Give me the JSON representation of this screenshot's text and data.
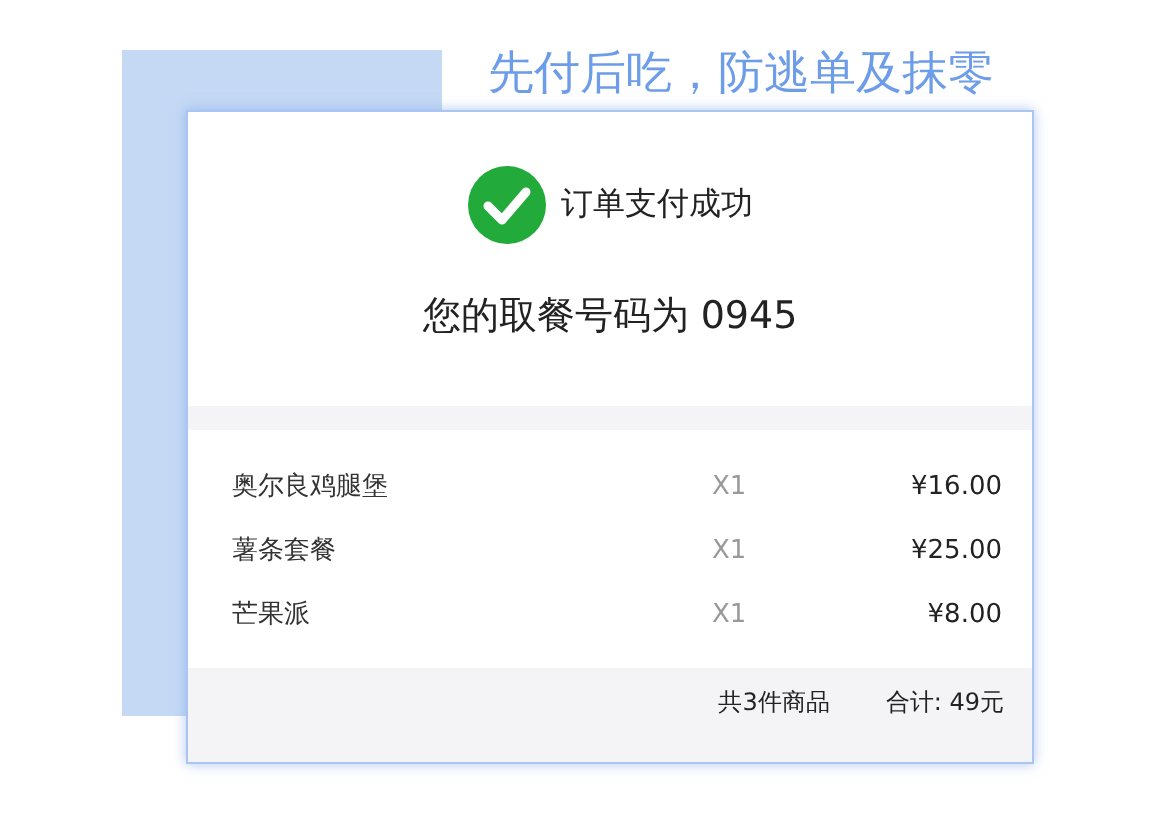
{
  "headline": "先付后吃，防逃单及抹零",
  "receipt": {
    "status": "订单支付成功",
    "pickup": "您的取餐号码为 0945",
    "items": [
      {
        "name": "奥尔良鸡腿堡",
        "qty": "X1",
        "price": "¥16.00"
      },
      {
        "name": "薯条套餐",
        "qty": "X1",
        "price": "¥25.00"
      },
      {
        "name": "芒果派",
        "qty": "X1",
        "price": "¥8.00"
      }
    ],
    "count": "共3件商品",
    "total": "合计: 49元"
  }
}
